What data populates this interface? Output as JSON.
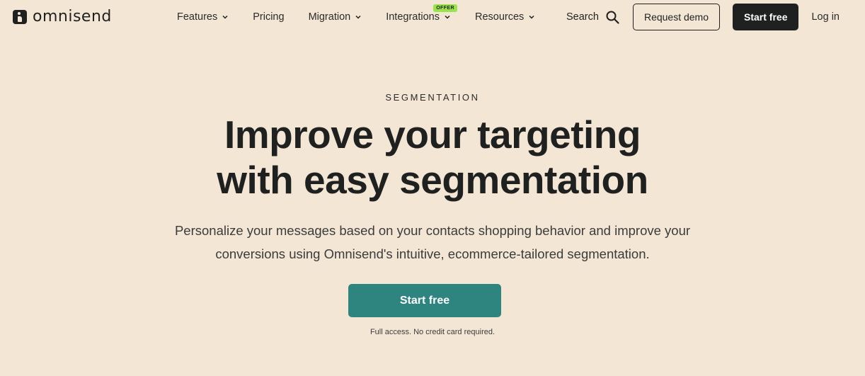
{
  "brand": {
    "name": "omnisend"
  },
  "nav": {
    "items": [
      {
        "label": "Features",
        "has_dropdown": true
      },
      {
        "label": "Pricing",
        "has_dropdown": false
      },
      {
        "label": "Migration",
        "has_dropdown": true
      },
      {
        "label": "Integrations",
        "has_dropdown": true,
        "badge": "OFFER"
      },
      {
        "label": "Resources",
        "has_dropdown": true
      }
    ],
    "search_label": "Search",
    "request_demo_label": "Request demo",
    "start_free_label": "Start free",
    "login_label": "Log in"
  },
  "hero": {
    "eyebrow": "SEGMENTATION",
    "headline_line1": "Improve your targeting",
    "headline_line2": "with easy segmentation",
    "subtitle_line1": "Personalize your messages based on your contacts shopping behavior and improve your",
    "subtitle_line2": "conversions using Omnisend's intuitive, ecommerce-tailored segmentation.",
    "cta_label": "Start free",
    "note": "Full access. No credit card required."
  },
  "colors": {
    "background": "#f4e6d4",
    "text": "#1f2121",
    "cta": "#2e8580",
    "offer_badge": "#9be34a"
  },
  "icons": {
    "logo": "omnisend-logo-icon",
    "search": "search-icon",
    "dropdown": "chevron-down-icon"
  }
}
